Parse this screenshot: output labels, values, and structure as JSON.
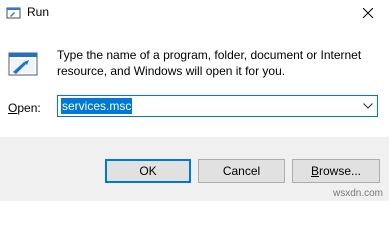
{
  "window": {
    "title": "Run",
    "app_icon": "run-icon",
    "close_icon": "close-icon"
  },
  "dialog": {
    "icon": "run-icon",
    "description": "Type the name of a program, folder, document or Internet resource, and Windows will open it for you.",
    "open_label_first": "O",
    "open_label_rest": "pen:",
    "input_value": "services.msc",
    "dropdown_icon": "chevron-down-icon"
  },
  "buttons": {
    "ok": "OK",
    "cancel": "Cancel",
    "browse_first": "B",
    "browse_rest": "rowse..."
  },
  "watermark": "wsxdn.com",
  "colors": {
    "accent": "#0078d7",
    "button_face": "#e1e1e1",
    "footer": "#f0f0f0"
  }
}
